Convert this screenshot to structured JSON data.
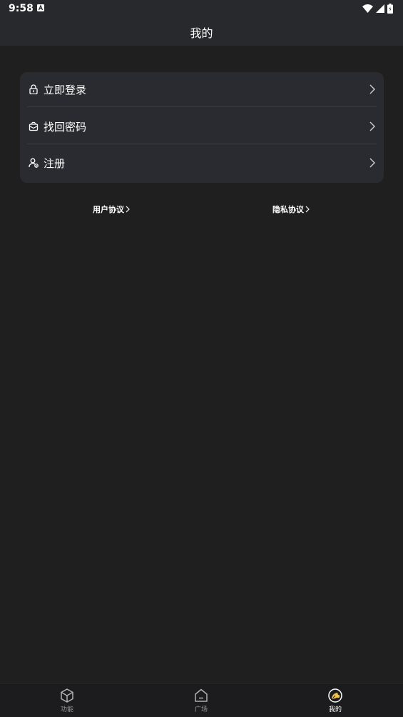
{
  "status_bar": {
    "time": "9:58"
  },
  "header": {
    "title": "我的"
  },
  "menu": {
    "items": [
      {
        "label": "立即登录",
        "icon": "lock-icon"
      },
      {
        "label": "找回密码",
        "icon": "recover-box-icon"
      },
      {
        "label": "注册",
        "icon": "user-register-icon"
      }
    ]
  },
  "agreements": {
    "user": "用户协议",
    "privacy": "隐私协议"
  },
  "bottom_nav": {
    "tabs": [
      {
        "label": "功能",
        "icon": "cube-icon"
      },
      {
        "label": "广场",
        "icon": "home-icon"
      },
      {
        "label": "我的",
        "icon": "profile-icon",
        "active": true
      }
    ]
  },
  "colors": {
    "background": "#1f1f1f",
    "bar": "#28292d",
    "card": "#2a2b30",
    "accent": "#f2c14e"
  }
}
